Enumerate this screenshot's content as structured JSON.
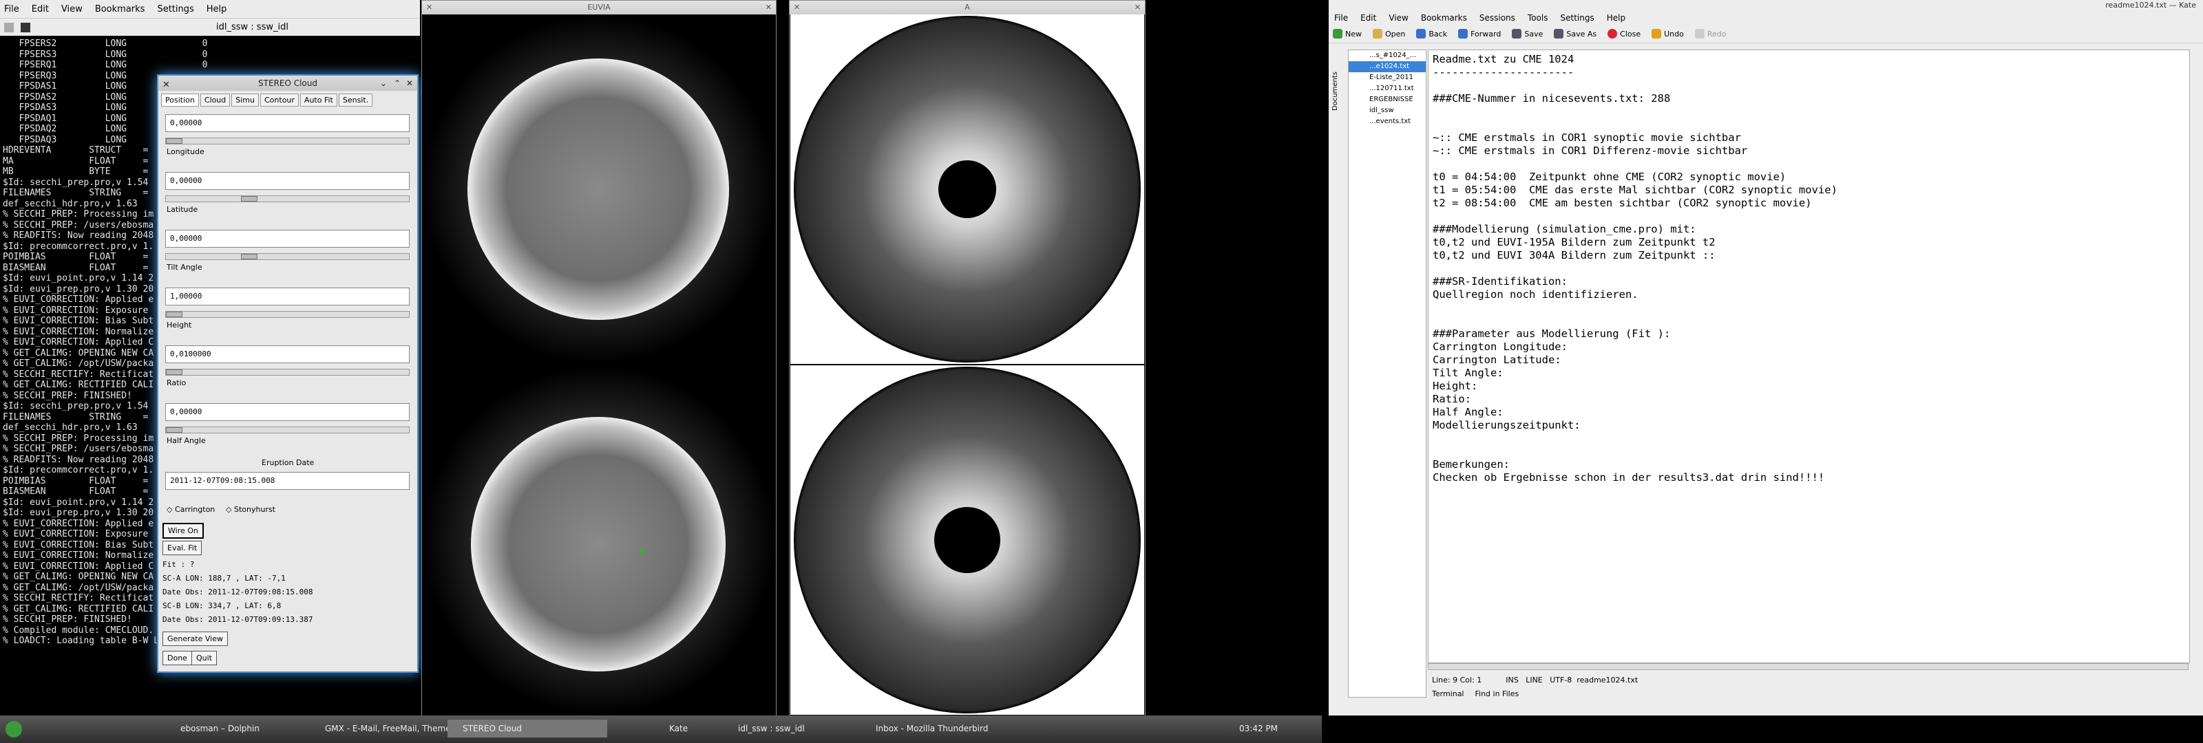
{
  "terminal": {
    "menu": [
      "File",
      "Edit",
      "View",
      "Bookmarks",
      "Settings",
      "Help"
    ],
    "tab_label": "idl_ssw : ssw_idl",
    "lines": [
      "   FPSERS2         LONG              0",
      "   FPSERS3         LONG              0",
      "   FPSERQ1         LONG              0",
      "",
      "   FPSERQ3         LONG",
      "   FPSDAS1         LONG",
      "   FPSDAS2         LONG",
      "   FPSDAS3         LONG",
      "   FPSDAQ1         LONG",
      "   FPSDAQ2         LONG",
      "   FPSDAQ3         LONG",
      "HDREVENTA       STRUCT    =",
      "MA              FLOAT     =",
      "MB              BYTE      =",
      "",
      "$Id: secchi_prep.pro,v 1.54",
      "FILENAMES       STRING    =",
      "def_secchi_hdr.pro,v 1.63",
      "% SECCHI_PREP: Processing im",
      "% SECCHI_PREP: /users/ebosma",
      "% READFITS: Now reading 2048",
      "$Id: precommcorrect.pro,v 1.",
      "POIMBIAS        FLOAT     =",
      "BIASMEAN        FLOAT     =",
      "$Id: euvi_point.pro,v 1.14 2",
      "$Id: euvi_prep.pro,v 1.30 20",
      "% EUVI_CORRECTION: Applied e",
      "% EUVI_CORRECTION: Exposure",
      "% EUVI_CORRECTION: Bias Subt",
      "% EUVI_CORRECTION: Normalize",
      "% EUVI_CORRECTION: Applied C",
      "% GET_CALIMG: OPENING NEW CA",
      "% GET_CALIMG: /opt/USW/packa",
      "% SECCHI_RECTIFY: Rectificat",
      "% GET_CALIMG: RECTIFIED CALI",
      "% SECCHI_PREP: FINISHED!",
      "",
      "$Id: secchi_prep.pro,v 1.54",
      "FILENAMES       STRING    =",
      "def_secchi_hdr.pro,v 1.63",
      "% SECCHI_PREP: Processing im",
      "% SECCHI_PREP: /users/ebosma",
      "% READFITS: Now reading 2048",
      "$Id: precommcorrect.pro,v 1.",
      "POIMBIAS        FLOAT     =",
      "BIASMEAN        FLOAT     =",
      "$Id: euvi_point.pro,v 1.14 2",
      "$Id: euvi_prep.pro,v 1.30 20",
      "% EUVI_CORRECTION: Applied e",
      "% EUVI_CORRECTION: Exposure",
      "% EUVI_CORRECTION: Bias Subt",
      "% EUVI_CORRECTION: Normalize",
      "% EUVI_CORRECTION: Applied C",
      "% GET_CALIMG: OPENING NEW CA",
      "% GET_CALIMG: /opt/USW/packa",
      "% SECCHI_RECTIFY: Rectificat",
      "% GET_CALIMG: RECTIFIED CALI",
      "% SECCHI_PREP: FINISHED!",
      "% Compiled module: CMECLOUD.",
      "% LOADCT: Loading table B-W LINEAR"
    ]
  },
  "cloud": {
    "title": "STEREO Cloud",
    "tabs": [
      "Position",
      "Cloud",
      "Simu",
      "Contour",
      "Auto Fit",
      "Sensit."
    ],
    "fields": [
      {
        "value": "0,00000",
        "label": "Longitude",
        "thumb": 0.0
      },
      {
        "value": "0,00000",
        "label": "Latitude",
        "thumb": 0.33
      },
      {
        "value": "0,00000",
        "label": "Tilt Angle",
        "thumb": 0.33
      },
      {
        "value": "1,00000",
        "label": "Height",
        "thumb": 0.0
      },
      {
        "value": "0,0100000",
        "label": "Ratio",
        "thumb": 0.0
      },
      {
        "value": "0,00000",
        "label": "Half Angle",
        "thumb": 0.0
      }
    ],
    "eruption_label": "Eruption Date",
    "eruption_value": "2011-12-07T09:08:15.008",
    "radio_carrington": "Carrington",
    "radio_stonyhurst": "Stonyhurst",
    "wire_on": "Wire On",
    "eval_fit": "Eval. Fit",
    "fit": "Fit : ?",
    "sca": "SC-A LON:  188,7  , LAT:  -7,1",
    "date_a": "Date Obs: 2011-12-07T09:08:15.008",
    "scb": "SC-B LON:  334,7  , LAT:   6,8",
    "date_b": "Date Obs: 2011-12-07T09:09:13.387",
    "generate_view": "Generate View",
    "done": "Done",
    "quit": "Quit"
  },
  "images": {
    "euvi_title": "EUVIA",
    "cor_title": "A"
  },
  "kate": {
    "window_title": "readme1024.txt — Kate",
    "menu": [
      "File",
      "Edit",
      "View",
      "Bookmarks",
      "Sessions",
      "Tools",
      "Settings",
      "Help"
    ],
    "toolbar": [
      "New",
      "Open",
      "Back",
      "Forward",
      "Save",
      "Save As",
      "Close",
      "Undo",
      "Redo"
    ],
    "side_tab": "Documents",
    "files": [
      "...s_#1024_...",
      "...e1024.txt",
      "E-Liste_2011",
      "...120711.txt",
      "ERGEBNISSE",
      "idl_ssw",
      "...events.txt"
    ],
    "text_lines": [
      "Readme.txt zu CME 1024",
      "----------------------",
      "",
      "###CME-Nummer in nicesevents.txt: 288",
      "",
      "",
      "~:: CME erstmals in COR1 synoptic movie sichtbar",
      "~:: CME erstmals in COR1 Differenz-movie sichtbar",
      "",
      "t0 = 04:54:00  Zeitpunkt ohne CME (COR2 synoptic movie)",
      "t1 = 05:54:00  CME das erste Mal sichtbar (COR2 synoptic movie)",
      "t2 = 08:54:00  CME am besten sichtbar (COR2 synoptic movie)",
      "",
      "###Modellierung (simulation_cme.pro) mit:",
      "t0,t2 und EUVI-195A Bildern zum Zeitpunkt t2",
      "t0,t2 und EUVI 304A Bildern zum Zeitpunkt ::",
      "",
      "###SR-Identifikation:",
      "Quellregion noch identifizieren.",
      "",
      "",
      "###Parameter aus Modellierung (Fit ):",
      "Carrington Longitude:",
      "Carrington Latitude:",
      "Tilt Angle:",
      "Height:",
      "Ratio:",
      "Half Angle:",
      "Modellierungszeitpunkt:",
      "",
      "",
      "Bemerkungen:",
      "Checken ob Ergebnisse schon in der results3.dat drin sind!!!!"
    ],
    "status": "Line: 9 Col: 1          INS   LINE   UTF-8  readme1024.txt",
    "bottom_tabs": [
      "Terminal",
      "Find in Files"
    ]
  },
  "taskbar": {
    "tasks": [
      "ebosman – Dolphin",
      "GMX - E-Mail, FreeMail, Themen- & Sh",
      "STEREO Cloud",
      "Kate",
      "idl_ssw : ssw_idl",
      "Inbox - Mozilla Thunderbird"
    ],
    "clock": "03:42 PM"
  }
}
